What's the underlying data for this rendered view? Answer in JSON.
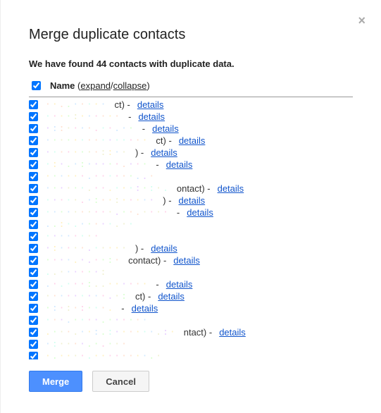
{
  "dialog": {
    "title": "Merge duplicate contacts",
    "subtitle": "We have found 44 contacts with duplicate data.",
    "close_glyph": "×"
  },
  "header": {
    "name_label": "Name",
    "paren_open": " (",
    "expand": "expand",
    "slash": "/",
    "collapse": "collapse",
    "paren_close": ")"
  },
  "rows": [
    {
      "checked": true,
      "obf_len": 14,
      "suffix": "ct) - ",
      "details": "details"
    },
    {
      "checked": true,
      "obf_len": 16,
      "suffix": " - ",
      "details": "details"
    },
    {
      "checked": true,
      "obf_len": 15,
      "suffix": " - ",
      "details": "details"
    },
    {
      "checked": true,
      "obf_len": 18,
      "suffix": "ct) - ",
      "details": "details"
    },
    {
      "checked": true,
      "obf_len": 17,
      "suffix": ") - ",
      "details": "details"
    },
    {
      "checked": true,
      "obf_len": 19,
      "suffix": " - ",
      "details": "details"
    },
    {
      "checked": true,
      "obf_len": 20,
      "suffix": "",
      "details": ""
    },
    {
      "checked": true,
      "obf_len": 24,
      "suffix": "ontact) - ",
      "details": "details"
    },
    {
      "checked": true,
      "obf_len": 22,
      "suffix": ") - ",
      "details": "details"
    },
    {
      "checked": true,
      "obf_len": 21,
      "suffix": " - ",
      "details": "details"
    },
    {
      "checked": true,
      "obf_len": 16,
      "suffix": "",
      "details": ""
    },
    {
      "checked": true,
      "obf_len": 14,
      "suffix": "",
      "details": ""
    },
    {
      "checked": true,
      "obf_len": 18,
      "suffix": ") - ",
      "details": "details"
    },
    {
      "checked": true,
      "obf_len": 20,
      "suffix": " contact) - ",
      "details": "details"
    },
    {
      "checked": true,
      "obf_len": 11,
      "suffix": "",
      "details": ""
    },
    {
      "checked": true,
      "obf_len": 18,
      "suffix": " - ",
      "details": "details"
    },
    {
      "checked": true,
      "obf_len": 16,
      "suffix": "ct) - ",
      "details": "details"
    },
    {
      "checked": true,
      "obf_len": 22,
      "suffix": " - ",
      "details": "details"
    },
    {
      "checked": true,
      "obf_len": 18,
      "suffix": "",
      "details": ""
    },
    {
      "checked": true,
      "obf_len": 26,
      "suffix": "ntact) - ",
      "details": "details"
    },
    {
      "checked": true,
      "obf_len": 17,
      "suffix": "",
      "details": ""
    },
    {
      "checked": true,
      "obf_len": 19,
      "suffix": "",
      "details": ""
    },
    {
      "checked": true,
      "obf_len": 15,
      "suffix": "",
      "details": ""
    },
    {
      "checked": true,
      "obf_len": 18,
      "suffix": "",
      "details": ""
    },
    {
      "checked": true,
      "obf_len": 20,
      "suffix": "",
      "details": ""
    }
  ],
  "obf_colors": [
    "#d0e8ff",
    "#ffe0d0",
    "#d8ffd0",
    "#fff0c0",
    "#e8d0ff",
    "#ffd0e8",
    "#d0fff0",
    "#f0f0d0"
  ],
  "footer": {
    "merge": "Merge",
    "cancel": "Cancel"
  }
}
